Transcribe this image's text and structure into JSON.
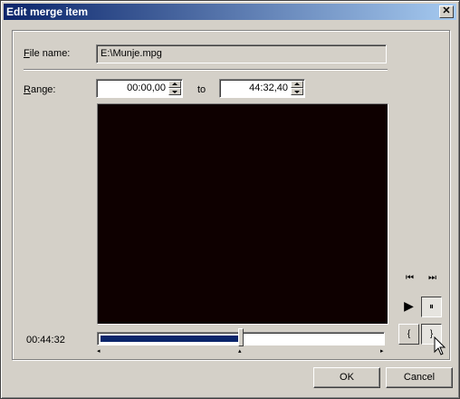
{
  "window": {
    "title": "Edit merge item",
    "close_glyph": "✕"
  },
  "file": {
    "label_accel": "F",
    "label_rest": "ile name:",
    "value": "E:\\Munje.mpg"
  },
  "range": {
    "label_accel": "R",
    "label_rest": "ange:",
    "from": "00:00,00",
    "to_label": "to",
    "to": "44:32,40"
  },
  "controls": {
    "prev_glyph": "⏮",
    "next_glyph": "⏭",
    "play_glyph": "▶",
    "pause_glyph": "⏸",
    "mark_in_glyph": "{",
    "mark_out_glyph": "}"
  },
  "timeline": {
    "current_time": "00:44:32",
    "progress": 0.49
  },
  "buttons": {
    "ok": "OK",
    "cancel": "Cancel"
  }
}
